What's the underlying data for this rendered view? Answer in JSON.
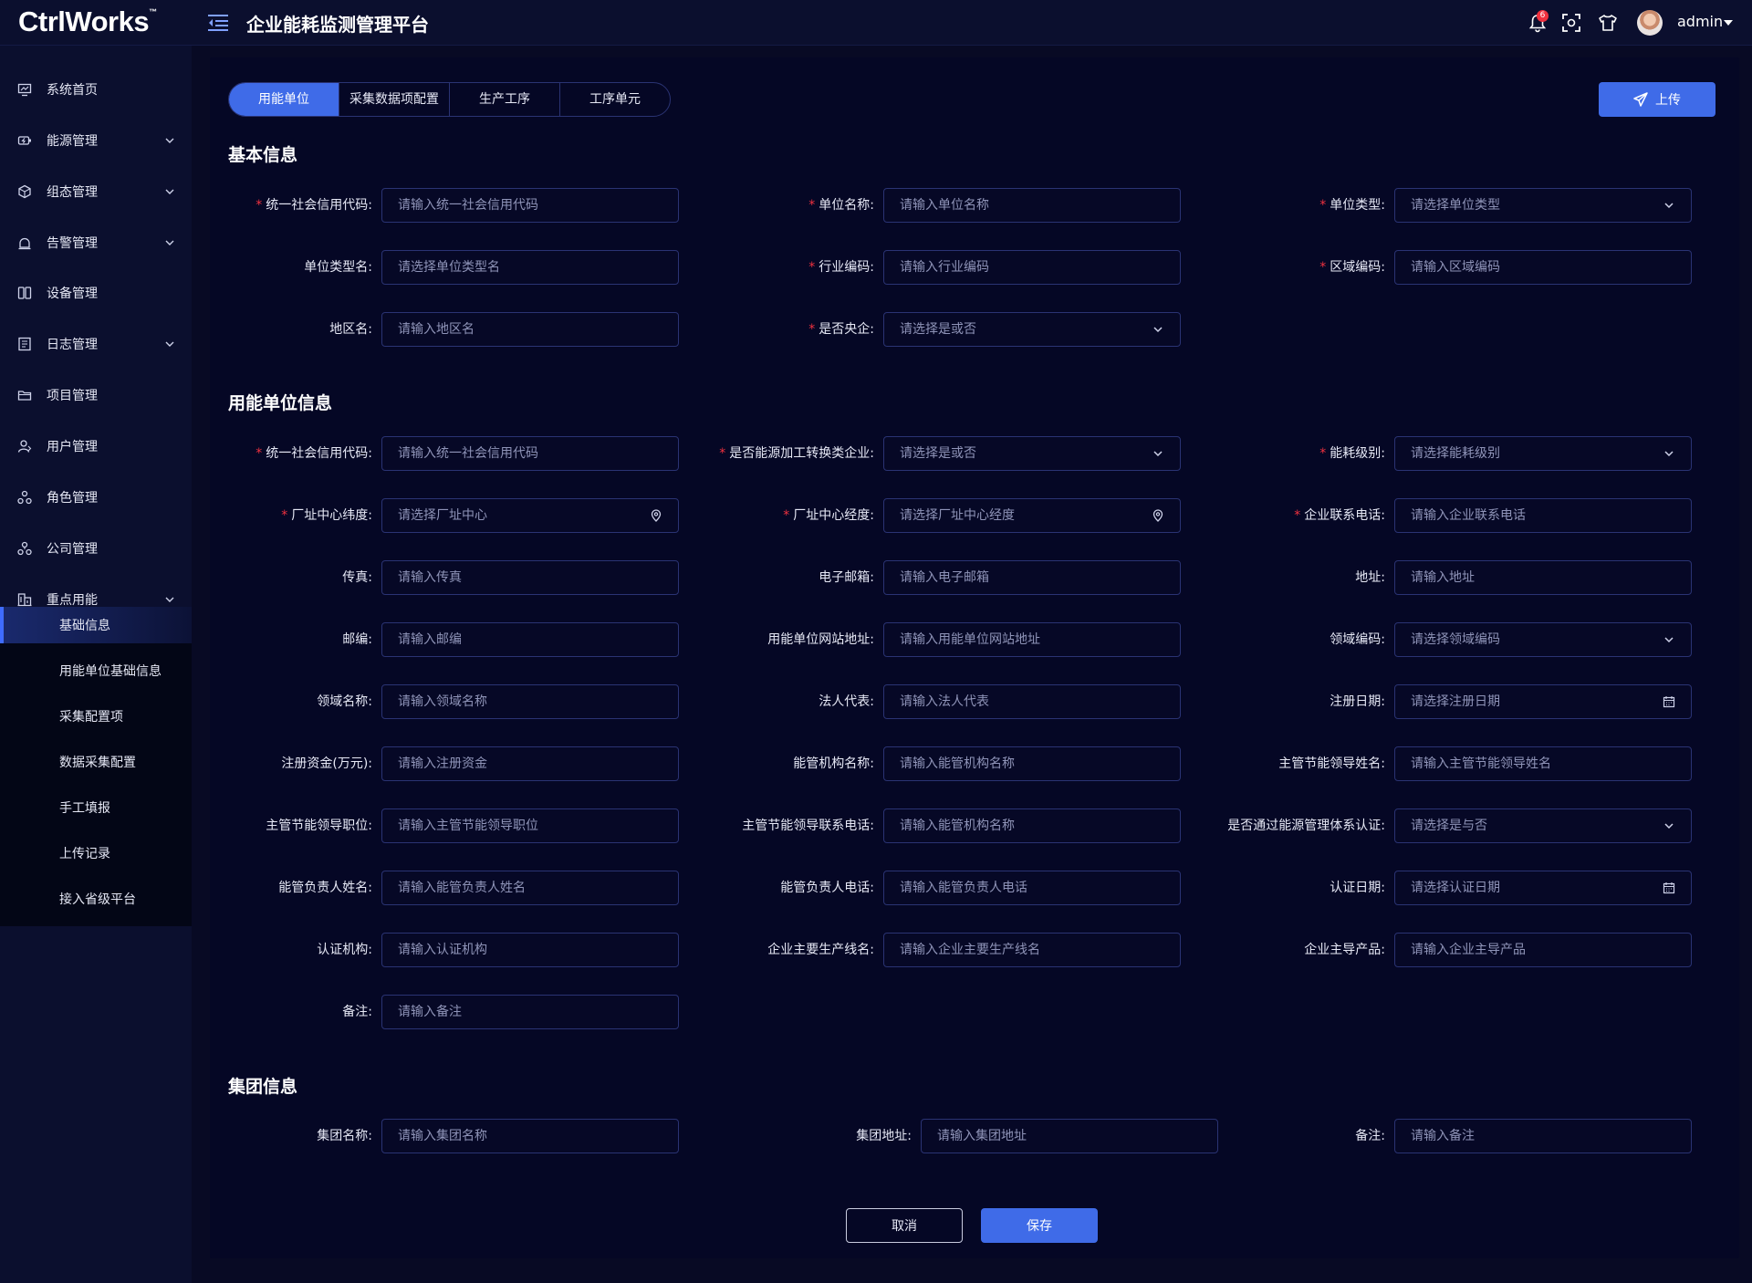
{
  "header": {
    "logo": "CtrlWorks",
    "logo_mark": "™",
    "app_title": "企业能耗监测管理平台",
    "notification_count": "6",
    "username": "admin"
  },
  "sidebar": {
    "items": [
      {
        "label": "系统首页",
        "icon": "monitor-icon",
        "expandable": false
      },
      {
        "label": "能源管理",
        "icon": "battery-icon",
        "expandable": true
      },
      {
        "label": "组态管理",
        "icon": "cube-icon",
        "expandable": true
      },
      {
        "label": "告警管理",
        "icon": "alarm-icon",
        "expandable": true
      },
      {
        "label": "设备管理",
        "icon": "device-icon",
        "expandable": false
      },
      {
        "label": "日志管理",
        "icon": "log-icon",
        "expandable": true
      },
      {
        "label": "项目管理",
        "icon": "folder-icon",
        "expandable": false
      },
      {
        "label": "用户管理",
        "icon": "user-icon",
        "expandable": false
      },
      {
        "label": "角色管理",
        "icon": "role-icon",
        "expandable": false
      },
      {
        "label": "公司管理",
        "icon": "company-icon",
        "expandable": false
      },
      {
        "label": "重点用能",
        "icon": "building-icon",
        "expandable": true
      }
    ],
    "subitems": [
      "基础信息",
      "用能单位基础信息",
      "采集配置项",
      "数据采集配置",
      "手工填报",
      "上传记录",
      "接入省级平台"
    ],
    "active_subitem": "基础信息"
  },
  "tabs": [
    "用能单位",
    "采集数据项配置",
    "生产工序",
    "工序单元"
  ],
  "active_tab": "用能单位",
  "upload_label": "上传",
  "sections": {
    "basic": "基本信息",
    "unit": "用能单位信息",
    "group": "集团信息"
  },
  "basic_fields": [
    {
      "label": "统一社会信用代码:",
      "placeholder": "请输入统一社会信用代码",
      "required": true,
      "type": "text"
    },
    {
      "label": "单位名称:",
      "placeholder": "请输入单位名称",
      "required": true,
      "type": "text"
    },
    {
      "label": "单位类型:",
      "placeholder": "请选择单位类型",
      "required": true,
      "type": "select"
    },
    {
      "label": "单位类型名:",
      "placeholder": "请选择单位类型名",
      "required": false,
      "type": "text"
    },
    {
      "label": "行业编码:",
      "placeholder": "请输入行业编码",
      "required": true,
      "type": "text"
    },
    {
      "label": "区域编码:",
      "placeholder": "请输入区域编码",
      "required": true,
      "type": "text"
    },
    {
      "label": "地区名:",
      "placeholder": "请输入地区名",
      "required": false,
      "type": "text"
    },
    {
      "label": "是否央企:",
      "placeholder": "请选择是或否",
      "required": true,
      "type": "select"
    }
  ],
  "unit_fields": [
    {
      "label": "统一社会信用代码:",
      "placeholder": "请输入统一社会信用代码",
      "required": true,
      "type": "text"
    },
    {
      "label": "是否能源加工转换类企业:",
      "placeholder": "请选择是或否",
      "required": true,
      "type": "select"
    },
    {
      "label": "能耗级别:",
      "placeholder": "请选择能耗级别",
      "required": true,
      "type": "select"
    },
    {
      "label": "厂址中心纬度:",
      "placeholder": "请选择厂址中心",
      "required": true,
      "type": "location"
    },
    {
      "label": "厂址中心经度:",
      "placeholder": "请选择厂址中心经度",
      "required": true,
      "type": "location"
    },
    {
      "label": "企业联系电话:",
      "placeholder": "请输入企业联系电话",
      "required": true,
      "type": "text"
    },
    {
      "label": "传真:",
      "placeholder": "请输入传真",
      "required": false,
      "type": "text"
    },
    {
      "label": "电子邮箱:",
      "placeholder": "请输入电子邮箱",
      "required": false,
      "type": "text"
    },
    {
      "label": "地址:",
      "placeholder": "请输入地址",
      "required": false,
      "type": "text"
    },
    {
      "label": "邮编:",
      "placeholder": "请输入邮编",
      "required": false,
      "type": "text"
    },
    {
      "label": "用能单位网站地址:",
      "placeholder": "请输入用能单位网站地址",
      "required": false,
      "type": "text"
    },
    {
      "label": "领域编码:",
      "placeholder": "请选择领域编码",
      "required": false,
      "type": "select"
    },
    {
      "label": "领域名称:",
      "placeholder": "请输入领域名称",
      "required": false,
      "type": "text"
    },
    {
      "label": "法人代表:",
      "placeholder": "请输入法人代表",
      "required": false,
      "type": "text"
    },
    {
      "label": "注册日期:",
      "placeholder": "请选择注册日期",
      "required": false,
      "type": "date"
    },
    {
      "label": "注册资金(万元):",
      "placeholder": "请输入注册资金",
      "required": false,
      "type": "text"
    },
    {
      "label": "能管机构名称:",
      "placeholder": "请输入能管机构名称",
      "required": false,
      "type": "text"
    },
    {
      "label": "主管节能领导姓名:",
      "placeholder": "请输入主管节能领导姓名",
      "required": false,
      "type": "text"
    },
    {
      "label": "主管节能领导职位:",
      "placeholder": "请输入主管节能领导职位",
      "required": false,
      "type": "text"
    },
    {
      "label": "主管节能领导联系电话:",
      "placeholder": "请输入能管机构名称",
      "required": false,
      "type": "text"
    },
    {
      "label": "是否通过能源管理体系认证:",
      "placeholder": "请选择是与否",
      "required": false,
      "type": "select"
    },
    {
      "label": "能管负责人姓名:",
      "placeholder": "请输入能管负责人姓名",
      "required": false,
      "type": "text"
    },
    {
      "label": "能管负责人电话:",
      "placeholder": "请输入能管负责人电话",
      "required": false,
      "type": "text"
    },
    {
      "label": "认证日期:",
      "placeholder": "请选择认证日期",
      "required": false,
      "type": "date"
    },
    {
      "label": "认证机构:",
      "placeholder": "请输入认证机构",
      "required": false,
      "type": "text"
    },
    {
      "label": "企业主要生产线名:",
      "placeholder": "请输入企业主要生产线名",
      "required": false,
      "type": "text"
    },
    {
      "label": "企业主导产品:",
      "placeholder": "请输入企业主导产品",
      "required": false,
      "type": "text"
    },
    {
      "label": "备注:",
      "placeholder": "请输入备注",
      "required": false,
      "type": "text"
    }
  ],
  "group_fields": [
    {
      "label": "集团名称:",
      "placeholder": "请输入集团名称",
      "required": false,
      "type": "text"
    },
    {
      "label": "集团地址:",
      "placeholder": "请输入集团地址",
      "required": false,
      "type": "text"
    },
    {
      "label": "备注:",
      "placeholder": "请输入备注",
      "required": false,
      "type": "text"
    }
  ],
  "buttons": {
    "cancel": "取消",
    "save": "保存"
  },
  "colors": {
    "accent": "#3f6be8",
    "required": "#f0313f",
    "background": "#080a24"
  }
}
